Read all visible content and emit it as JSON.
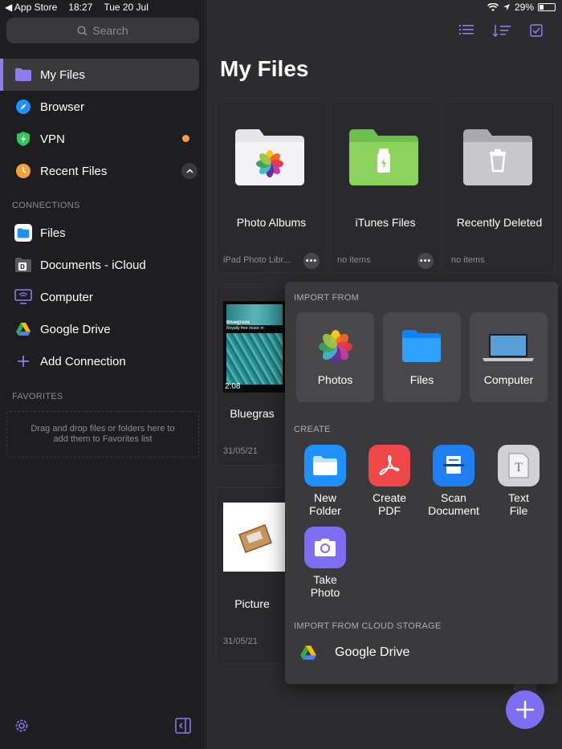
{
  "status": {
    "carrier": "◀ App Store",
    "time": "18:27",
    "date": "Tue 20 Jul",
    "battery": "29%"
  },
  "sidebar": {
    "search_placeholder": "Search",
    "items": [
      {
        "label": "My Files"
      },
      {
        "label": "Browser"
      },
      {
        "label": "VPN"
      },
      {
        "label": "Recent Files"
      }
    ],
    "connections_label": "CONNECTIONS",
    "connections": [
      {
        "label": "Files"
      },
      {
        "label": "Documents - iCloud"
      },
      {
        "label": "Computer"
      },
      {
        "label": "Google Drive"
      },
      {
        "label": "Add Connection"
      }
    ],
    "favorites_label": "FAVORITES",
    "favorites_hint_1": "Drag and drop files or folders here to",
    "favorites_hint_2": "add them to Favorites list"
  },
  "main": {
    "title": "My Files",
    "folders": [
      {
        "name": "Photo Albums",
        "sub": "iPad Photo Libr..."
      },
      {
        "name": "iTunes Files",
        "sub": "no items"
      },
      {
        "name": "Recently Deleted",
        "sub": "no items"
      }
    ],
    "files": [
      {
        "name": "Bluegras",
        "date": "31/05/21",
        "duration": "2:08",
        "thumb_line1": "Bluegrass",
        "thumb_line2": "Royalty free music m"
      },
      {
        "name": "Picture",
        "date": "31/05/21"
      }
    ]
  },
  "popover": {
    "import_label": "IMPORT FROM",
    "import_items": [
      {
        "label": "Photos"
      },
      {
        "label": "Files"
      },
      {
        "label": "Computer"
      }
    ],
    "create_label": "CREATE",
    "create_items": [
      {
        "line1": "New",
        "line2": "Folder"
      },
      {
        "line1": "Create",
        "line2": "PDF"
      },
      {
        "line1": "Scan",
        "line2": "Document"
      },
      {
        "line1": "Text",
        "line2": "File"
      },
      {
        "line1": "Take",
        "line2": "Photo"
      }
    ],
    "cloud_label": "IMPORT FROM CLOUD STORAGE",
    "cloud_item": "Google Drive"
  },
  "colors": {
    "accent": "#7e6cf2",
    "orange_dot": "#f2a23a",
    "folder_green": "#8bd35a"
  }
}
